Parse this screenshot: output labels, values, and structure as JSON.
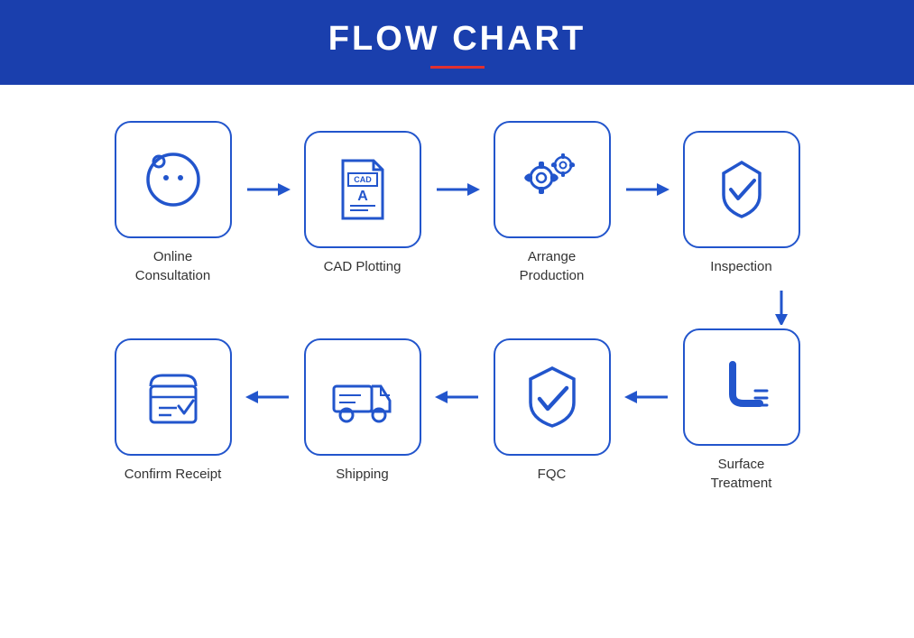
{
  "header": {
    "title": "FLOW CHART"
  },
  "steps": {
    "row1": [
      {
        "id": "online-consultation",
        "label": "Online\nConsultation"
      },
      {
        "id": "cad-plotting",
        "label": "CAD Plotting"
      },
      {
        "id": "arrange-production",
        "label": "Arrange\nProduction"
      },
      {
        "id": "inspection",
        "label": "Inspection"
      }
    ],
    "row2": [
      {
        "id": "confirm-receipt",
        "label": "Confirm Receipt"
      },
      {
        "id": "shipping",
        "label": "Shipping"
      },
      {
        "id": "fqc",
        "label": "FQC"
      },
      {
        "id": "surface-treatment",
        "label": "Surface\nTreatment"
      }
    ]
  },
  "colors": {
    "blue": "#2255cc",
    "header_bg": "#1a3fad",
    "red_line": "#e03030"
  }
}
